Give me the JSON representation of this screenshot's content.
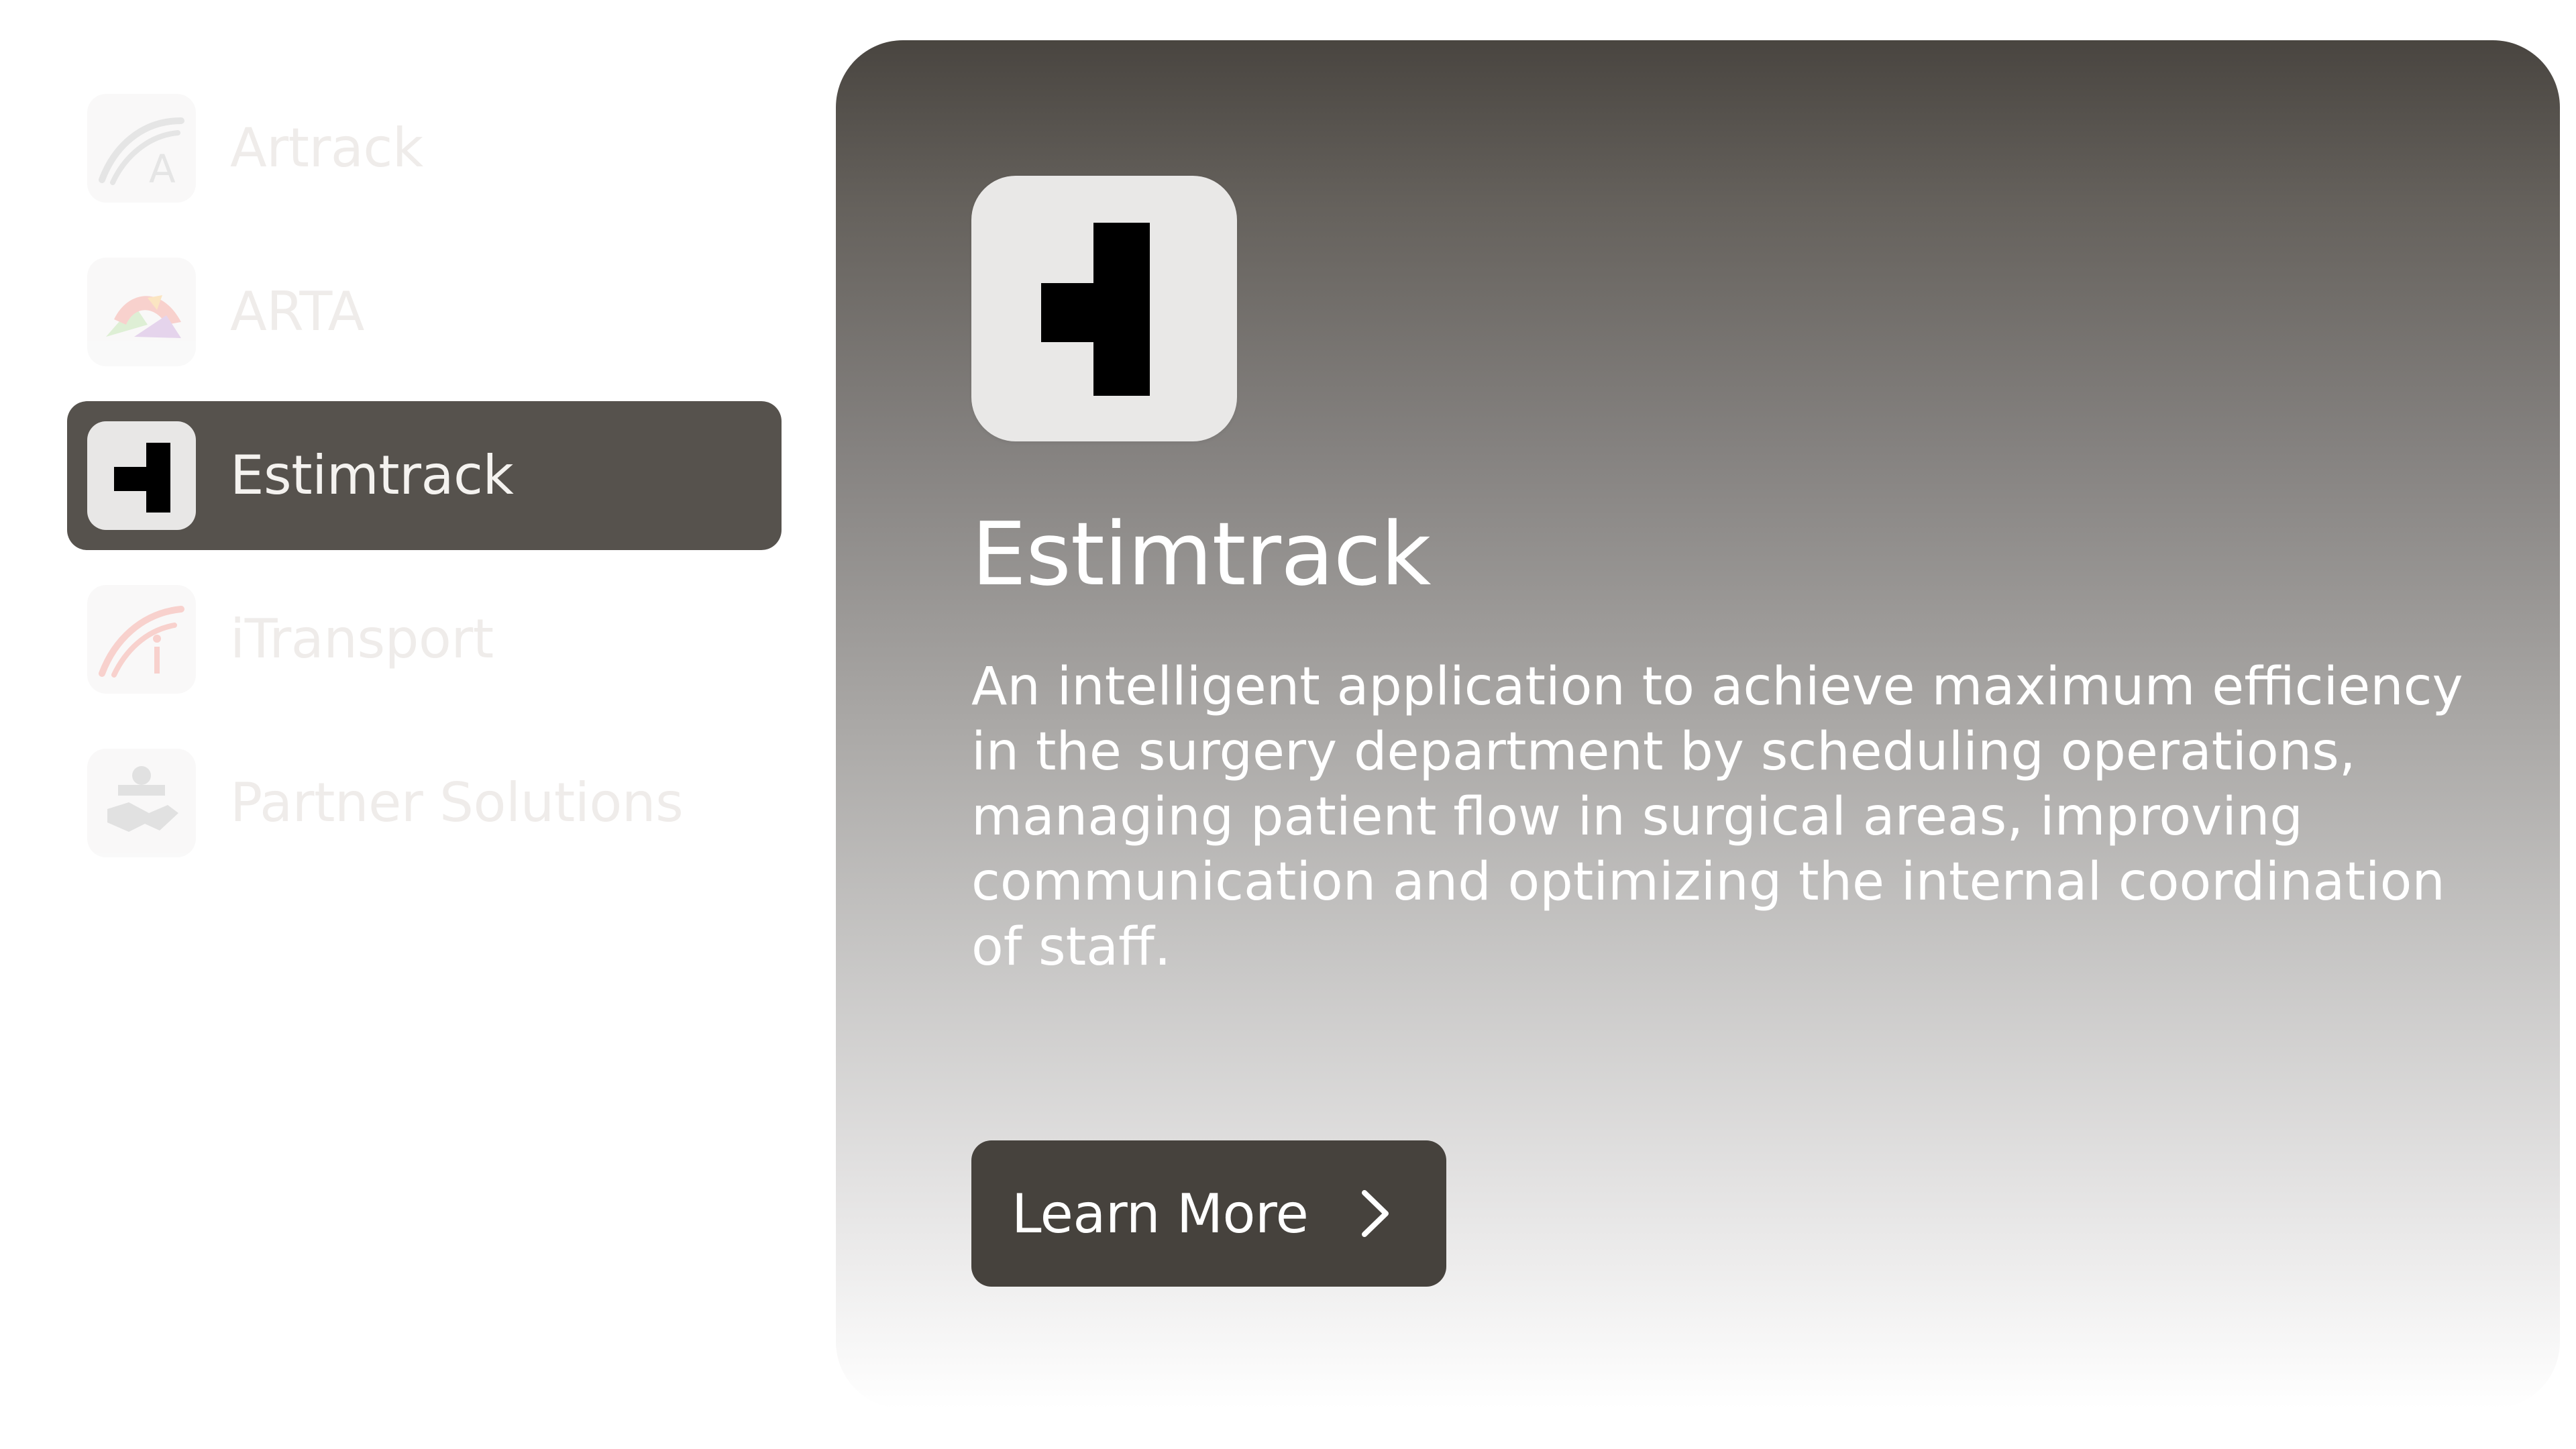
{
  "sidebar": {
    "items": [
      {
        "label": "Artrack",
        "icon": "artrack-logo-icon",
        "state": "faded"
      },
      {
        "label": "ARTA",
        "icon": "arta-logo-icon",
        "state": "faded"
      },
      {
        "label": "Estimtrack",
        "icon": "estimtrack-logo-icon",
        "state": "active"
      },
      {
        "label": "iTransport",
        "icon": "itransport-logo-icon",
        "state": "faded"
      },
      {
        "label": "Partner Solutions",
        "icon": "handshake-icon",
        "state": "faded"
      }
    ]
  },
  "detail": {
    "icon": "estimtrack-logo-icon",
    "title": "Estimtrack",
    "description": "An intelligent application to achieve maximum efficiency in the surgery department by scheduling operations, managing patient flow in surgical areas, improving communication and optimizing the internal coordination of staff.",
    "button_label": "Learn More",
    "button_icon": "chevron-right-icon"
  },
  "colors": {
    "active_item_bg": "#56524d",
    "button_bg": "#46423d",
    "panel_gradient_top": "#494540",
    "panel_gradient_bottom": "#ffffff"
  }
}
